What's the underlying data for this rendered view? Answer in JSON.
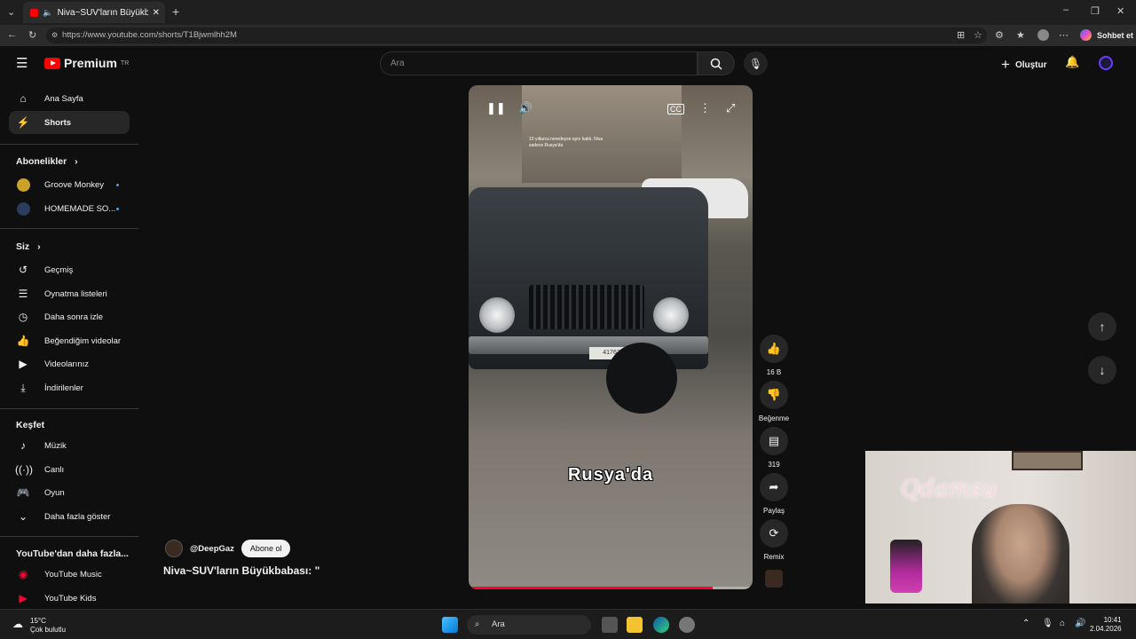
{
  "browser": {
    "tab_title": "Niva~SUV'ların Büyükbabası:",
    "url": "https://www.youtube.com/shorts/T1Bjwmlhh2M",
    "chat_label": "Sohbet et"
  },
  "header": {
    "logo_text": "Premium",
    "logo_region": "TR",
    "search_placeholder": "Ara",
    "create_label": "Oluştur"
  },
  "sidebar": {
    "main": [
      {
        "label": "Ana Sayfa",
        "icon": "home-icon"
      },
      {
        "label": "Shorts",
        "icon": "shorts-icon",
        "active": true
      }
    ],
    "subscriptions_title": "Abonelikler",
    "subscriptions": [
      {
        "label": "Groove Monkey",
        "color": "#c9a227"
      },
      {
        "label": "HOMEMADE SO...",
        "color": "#2a3d5c"
      }
    ],
    "you_title": "Siz",
    "you": [
      {
        "label": "Geçmiş",
        "icon": "history-icon"
      },
      {
        "label": "Oynatma listeleri",
        "icon": "playlist-icon"
      },
      {
        "label": "Daha sonra izle",
        "icon": "clock-icon"
      },
      {
        "label": "Beğendiğim videolar",
        "icon": "like-icon"
      },
      {
        "label": "Videolarınız",
        "icon": "video-icon"
      },
      {
        "label": "İndirilenler",
        "icon": "download-icon"
      }
    ],
    "explore_title": "Keşfet",
    "explore": [
      {
        "label": "Müzik",
        "icon": "music-icon"
      },
      {
        "label": "Canlı",
        "icon": "live-icon"
      },
      {
        "label": "Oyun",
        "icon": "gaming-icon"
      },
      {
        "label": "Daha fazla göster",
        "icon": "chevron-down-icon"
      }
    ],
    "more_title": "YouTube'dan daha fazla...",
    "more": [
      {
        "label": "YouTube Music",
        "color": "#ff0033"
      },
      {
        "label": "YouTube Kids",
        "color": "#ff0033"
      }
    ]
  },
  "short": {
    "overlay_text": "10 yıllarca neredeyse aynı kaldı. Niva sadece Rusya'da",
    "caption": "Rusya'da",
    "plate": "41763",
    "progress": 0.86,
    "channel": "@DeepGaz",
    "subscribe_label": "Abone ol",
    "title": "Niva~SUV'ların Büyükbabası: \""
  },
  "actions": {
    "likes": "16 B",
    "dislike_label": "Beğenme",
    "comments": "319",
    "share_label": "Paylaş",
    "remix_label": "Remix"
  },
  "webcam": {
    "neon_text": "Qdamsu"
  },
  "taskbar": {
    "weather_temp": "15°C",
    "weather_desc": "Çok bulutlu",
    "search_label": "Ara",
    "time": "10:41",
    "date": "2.04.2026"
  },
  "colors": {
    "accent": "#ff0033",
    "bg": "#0f0f0f",
    "link": "#3ea6ff"
  }
}
